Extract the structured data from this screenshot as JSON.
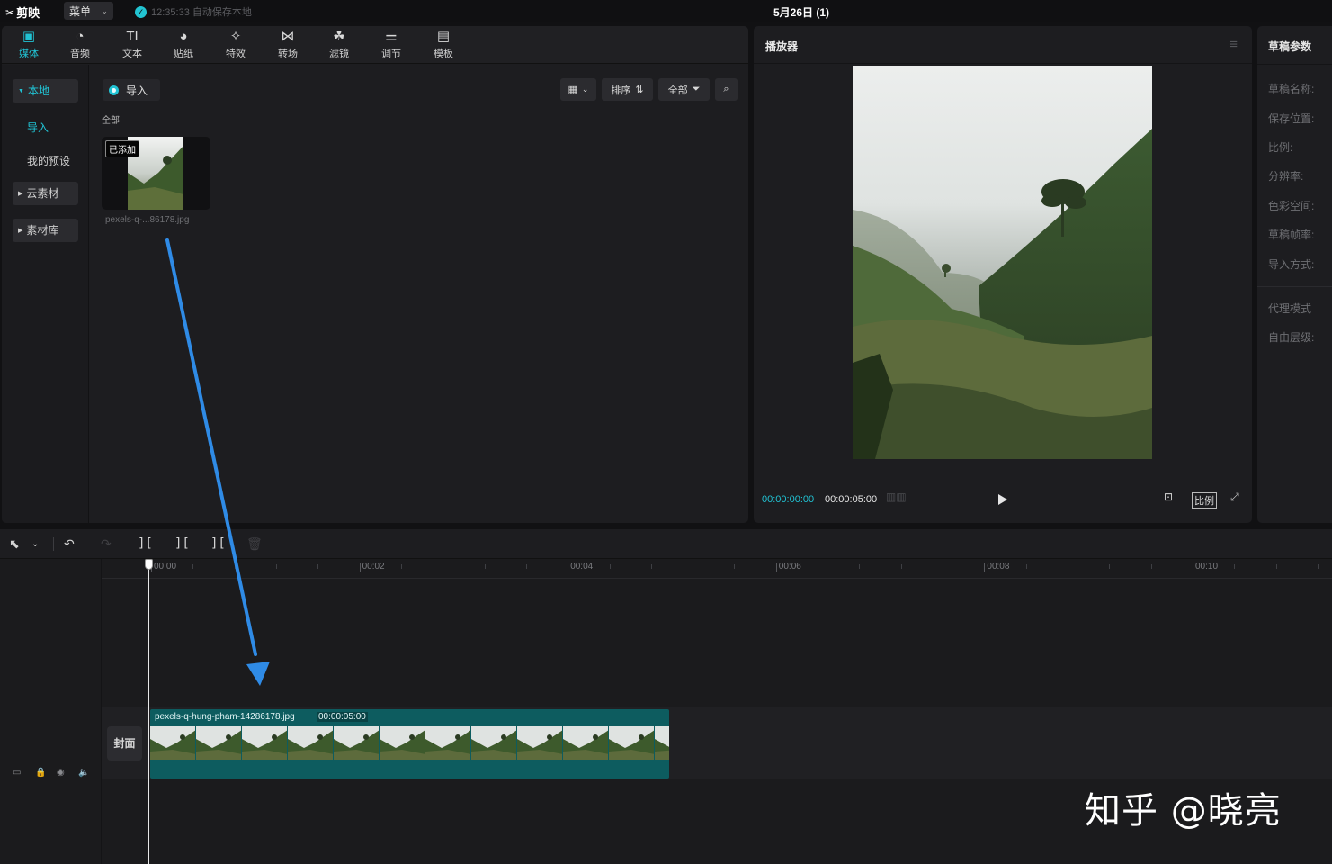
{
  "app": {
    "logo_text": "剪映",
    "menu_label": "菜单",
    "autosave_text": "12:35:33 自动保存本地",
    "project_title": "5月26日 (1)"
  },
  "media_tabs": [
    {
      "label": "媒体",
      "icon": "media-icon",
      "active": true
    },
    {
      "label": "音频",
      "icon": "audio-icon",
      "active": false
    },
    {
      "label": "文本",
      "icon": "text-icon",
      "active": false
    },
    {
      "label": "贴纸",
      "icon": "sticker-icon",
      "active": false
    },
    {
      "label": "特效",
      "icon": "effects-icon",
      "active": false
    },
    {
      "label": "转场",
      "icon": "transition-icon",
      "active": false
    },
    {
      "label": "滤镜",
      "icon": "filter-icon",
      "active": false
    },
    {
      "label": "调节",
      "icon": "adjust-icon",
      "active": false
    },
    {
      "label": "模板",
      "icon": "template-icon",
      "active": false
    }
  ],
  "media_side": {
    "local": "本地",
    "import": "导入",
    "my_presets": "我的预设",
    "cloud": "云素材",
    "library": "素材库"
  },
  "media_content": {
    "import_button": "导入",
    "sort_label": "排序",
    "filter_label": "全部",
    "section_label": "全部",
    "items": [
      {
        "badge": "已添加",
        "filename": "pexels-q-...86178.jpg"
      }
    ]
  },
  "player": {
    "title": "播放器",
    "current_time": "00:00:00:00",
    "total_time": "00:00:05:00",
    "ratio_label": "比例"
  },
  "draft_params": {
    "title": "草稿参数",
    "fields": [
      "草稿名称:",
      "保存位置:",
      "比例:",
      "分辨率:",
      "色彩空间:",
      "草稿帧率:",
      "导入方式:"
    ],
    "extra_fields": [
      "代理模式",
      "自由层级:"
    ]
  },
  "timeline": {
    "ruler_labels": [
      "00:00",
      "00:02",
      "00:04",
      "00:06",
      "00:08",
      "00:10"
    ],
    "clip": {
      "name": "pexels-q-hung-pham-14286178.jpg",
      "duration": "00:00:05:00"
    },
    "cover_label": "封面"
  },
  "watermark": "知乎 @晓亮",
  "colors": {
    "accent": "#21c3d4",
    "clip": "#0d5c5f",
    "arrow": "#2f8be6"
  }
}
